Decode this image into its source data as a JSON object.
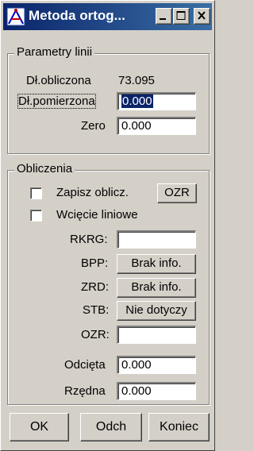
{
  "window": {
    "title": "Metoda ortog...",
    "controls": {
      "minimize_icon": "minimize-icon",
      "maximize_icon": "maximize-icon",
      "close_icon": "close-icon"
    },
    "accent": "#0a246a"
  },
  "parametry": {
    "legend": "Parametry linii",
    "dl_obliczona_label": "Dł.obliczona",
    "dl_obliczona_value": "73.095",
    "dl_pomierzona_label": "Dł.pomierzona",
    "dl_pomierzona_value": "0.000",
    "zero_label": "Zero",
    "zero_value": "0.000"
  },
  "obliczenia": {
    "legend": "Obliczenia",
    "zapisz_label": "Zapisz oblicz.",
    "zapisz_checked": false,
    "ozr_button": "OZR",
    "wciecie_label": "Wcięcie liniowe",
    "wciecie_checked": false,
    "rkrg_label": "RKRG:",
    "rkrg_value": "",
    "bpp_label": "BPP:",
    "bpp_button": "Brak info.",
    "zrd_label": "ZRD:",
    "zrd_button": "Brak info.",
    "stb_label": "STB:",
    "stb_button": "Nie dotyczy",
    "ozr_label": "OZR:",
    "ozr_value": "",
    "odcieta_label": "Odcięta",
    "odcieta_value": "0.000",
    "rzedna_label": "Rzędna",
    "rzedna_value": "0.000"
  },
  "footer": {
    "ok": "OK",
    "odch": "Odch",
    "koniec": "Koniec"
  }
}
